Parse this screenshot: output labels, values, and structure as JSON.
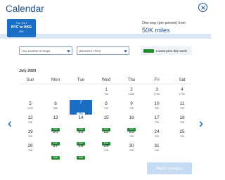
{
  "header": {
    "title": "Calendar"
  },
  "trip": {
    "date": "Tue, Jul 7",
    "route": "NYC to HKG",
    "price": "50K"
  },
  "oneway": {
    "label": "One way (per person) from",
    "value": "50K miles"
  },
  "filters": {
    "stops": "Any number of stops",
    "cabin": "Business / First",
    "legend_text": "Lowest price this month"
  },
  "calendar": {
    "month": "July 2020",
    "weekdays": [
      "Sun",
      "Mon",
      "Tue",
      "Wed",
      "Thu",
      "Fri",
      "Sat"
    ],
    "weeks": [
      [
        null,
        null,
        null,
        {
          "d": "1",
          "p": "70K"
        },
        {
          "d": "2",
          "p": "140K"
        },
        {
          "d": "3",
          "p": "173K"
        },
        {
          "d": "4",
          "p": "173K"
        }
      ],
      [
        {
          "d": "5",
          "p": "110K"
        },
        {
          "d": "6",
          "p": "58K"
        },
        {
          "d": "7",
          "p": "50K",
          "selected": true
        },
        {
          "d": "8",
          "p": "70K"
        },
        {
          "d": "9",
          "p": "70K"
        },
        {
          "d": "10",
          "p": "70K"
        },
        {
          "d": "11",
          "p": "70K"
        }
      ],
      [
        {
          "d": "12",
          "p": "70K"
        },
        {
          "d": "13",
          "p": "50K",
          "low": true
        },
        {
          "d": "14",
          "p": "50K",
          "low": true
        },
        {
          "d": "15",
          "p": "50K",
          "low": true
        },
        {
          "d": "16",
          "p": "50K",
          "low": true
        },
        {
          "d": "17",
          "p": "70K"
        },
        {
          "d": "18",
          "p": "70K"
        }
      ],
      [
        {
          "d": "19",
          "p": "70K"
        },
        {
          "d": "20",
          "p": "50K",
          "low": true
        },
        {
          "d": "21",
          "p": "50K",
          "low": true
        },
        {
          "d": "22",
          "p": "50K",
          "low": true
        },
        {
          "d": "23",
          "p": "70K"
        },
        {
          "d": "24",
          "p": "70K"
        },
        {
          "d": "25",
          "p": "70K"
        }
      ],
      [
        {
          "d": "26",
          "p": "70K"
        },
        {
          "d": "27",
          "p": "50K",
          "low": true
        },
        {
          "d": "28",
          "p": "50K",
          "low": true
        },
        {
          "d": "29",
          "p": "70K"
        },
        {
          "d": "30",
          "p": "70K"
        },
        {
          "d": "31",
          "p": "70K"
        },
        null
      ]
    ]
  },
  "apply_label": "Apply changes",
  "colors": {
    "brand": "#1a6fc4",
    "title": "#1c4f8a",
    "lowest_price": "#238c33",
    "apply_disabled": "#c6dcf2"
  }
}
